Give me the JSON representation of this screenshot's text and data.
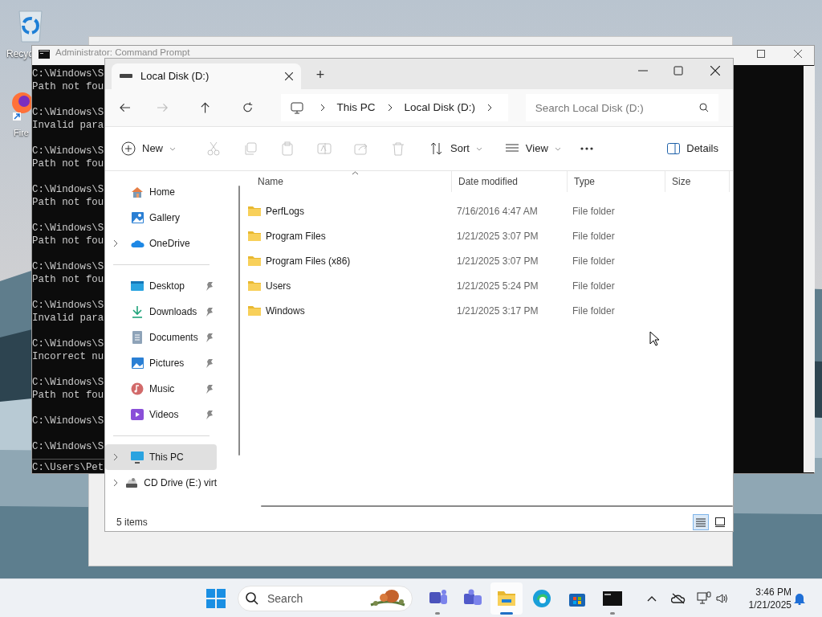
{
  "desktop_icons": [
    {
      "label": "Recyc"
    },
    {
      "label": "Fire"
    }
  ],
  "console": {
    "title": "Administrator: Command Prompt",
    "blocks": [
      [
        "C:\\Windows\\S",
        "Path not fou"
      ],
      [
        "C:\\Windows\\S",
        "Invalid para"
      ],
      [
        "C:\\Windows\\S",
        "Path not fou"
      ],
      [
        "C:\\Windows\\S",
        "Path not fou"
      ],
      [
        "C:\\Windows\\S",
        "Path not fou"
      ],
      [
        "C:\\Windows\\S",
        "Path not fou"
      ],
      [
        "C:\\Windows\\S",
        "Invalid para"
      ],
      [
        "C:\\Windows\\S",
        "Incorrect nu"
      ],
      [
        "C:\\Windows\\S",
        "Path not fou"
      ],
      [
        "C:\\Windows\\S"
      ],
      [
        "C:\\Windows\\S"
      ]
    ],
    "prompt": "C:\\Users\\Pet"
  },
  "explorer": {
    "tabs": [
      {
        "title": "Local Disk (D:)",
        "selected": true
      }
    ],
    "new_tab": "+",
    "breadcrumb": [
      "This PC",
      "Local Disk (D:)"
    ],
    "search": {
      "placeholder": "Search Local Disk (D:)"
    },
    "toolbar": [
      {
        "kind": "new",
        "label": "New",
        "disabled": false
      },
      {
        "kind": "cut",
        "disabled": true
      },
      {
        "kind": "copy",
        "disabled": true
      },
      {
        "kind": "paste",
        "disabled": true
      },
      {
        "kind": "rename",
        "disabled": true
      },
      {
        "kind": "share",
        "disabled": true
      },
      {
        "kind": "delete",
        "disabled": true
      },
      {
        "kind": "sort",
        "label": "Sort",
        "disabled": false
      },
      {
        "kind": "view",
        "label": "View",
        "disabled": false
      },
      {
        "kind": "more",
        "disabled": false
      }
    ],
    "details": "Details",
    "sidebar": [
      [
        {
          "label": "Home",
          "expandable": false,
          "pinned": false,
          "selected": false
        },
        {
          "label": "Gallery",
          "expandable": false,
          "pinned": false,
          "selected": false
        },
        {
          "label": "OneDrive",
          "expandable": true,
          "pinned": false,
          "selected": false
        }
      ],
      [
        {
          "label": "Desktop",
          "expandable": false,
          "pinned": true,
          "selected": false
        },
        {
          "label": "Downloads",
          "expandable": false,
          "pinned": true,
          "selected": false
        },
        {
          "label": "Documents",
          "expandable": false,
          "pinned": true,
          "selected": false
        },
        {
          "label": "Pictures",
          "expandable": false,
          "pinned": true,
          "selected": false
        },
        {
          "label": "Music",
          "expandable": false,
          "pinned": true,
          "selected": false
        },
        {
          "label": "Videos",
          "expandable": false,
          "pinned": true,
          "selected": false
        }
      ],
      [
        {
          "label": "This PC",
          "expandable": true,
          "pinned": false,
          "selected": true
        },
        {
          "label": "CD Drive (E:) virt",
          "expandable": true,
          "pinned": false,
          "selected": false
        }
      ]
    ],
    "columns": [
      {
        "label": "Name",
        "sorted": true
      },
      {
        "label": "Date modified",
        "sorted": false
      },
      {
        "label": "Type",
        "sorted": false
      },
      {
        "label": "Size",
        "sorted": false
      }
    ],
    "rows": [
      {
        "name": "PerfLogs",
        "date": "7/16/2016 4:47 AM",
        "type": "File folder"
      },
      {
        "name": "Program Files",
        "date": "1/21/2025 3:07 PM",
        "type": "File folder"
      },
      {
        "name": "Program Files (x86)",
        "date": "1/21/2025 3:07 PM",
        "type": "File folder"
      },
      {
        "name": "Users",
        "date": "1/21/2025 5:24 PM",
        "type": "File folder"
      },
      {
        "name": "Windows",
        "date": "1/21/2025 3:17 PM",
        "type": "File folder"
      }
    ],
    "status": "5 items",
    "views": [
      {
        "kind": "details",
        "selected": true
      },
      {
        "kind": "tiles",
        "selected": false
      }
    ]
  },
  "taskbar": {
    "search": {
      "placeholder": "Search"
    },
    "apps": [
      {
        "kind": "teams",
        "active": false,
        "running": true
      },
      {
        "kind": "teams2",
        "active": false,
        "running": false
      },
      {
        "kind": "explorer",
        "active": true,
        "running": true
      },
      {
        "kind": "edge",
        "active": false,
        "running": false
      },
      {
        "kind": "store",
        "active": false,
        "running": false
      },
      {
        "kind": "terminal",
        "active": false,
        "running": true
      }
    ],
    "time": "3:46 PM",
    "date": "1/21/2025"
  }
}
